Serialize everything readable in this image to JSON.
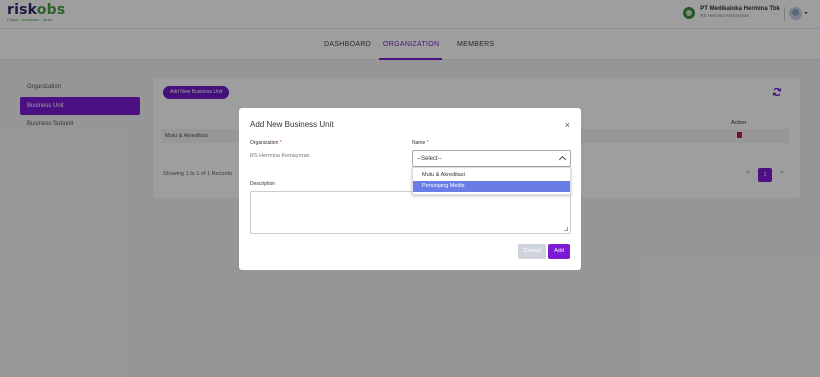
{
  "brand": {
    "name_main": "risk",
    "name_accent": "obs",
    "tagline": "Fokus - Komitmen - Mutu"
  },
  "company": {
    "name": "PT Medikaloka Hermina Tbk",
    "subtitle": "RS Hermina Kemayoran",
    "avatar_icon": "user-avatar-icon"
  },
  "nav": {
    "items": [
      "DASHBOARD",
      "ORGANIZATION",
      "MEMBERS"
    ],
    "active": "ORGANIZATION"
  },
  "sidebar": {
    "items": [
      "Organization",
      "Business Unit",
      "Business Subunit"
    ],
    "active": "Business Unit"
  },
  "main": {
    "add_button": "Add New Business Unit",
    "refresh_icon": "refresh-icon",
    "table": {
      "action_header": "Action",
      "rows": [
        {
          "name": "Mutu & Akreditasi",
          "action_icon": "trash-icon"
        }
      ]
    },
    "showing_text": "Showing 1 to 1 of 1 Records",
    "pagination": {
      "prev": "«",
      "current": "1",
      "next": "»"
    }
  },
  "modal": {
    "title": "Add New Business Unit",
    "close_icon": "×",
    "organization_label": "Organization",
    "organization_value": "RS Hermina Kemayoran",
    "name_label": "Name",
    "required_mark": "*",
    "name_select_value": "--Select--",
    "name_options": [
      "Mutu & Akreditasi",
      "Penunjang Medis"
    ],
    "highlighted_option": "Penunjang Medis",
    "description_label": "Description",
    "description_value": "",
    "cancel_label": "Cancel",
    "add_label": "Add"
  },
  "colors": {
    "accent": "#7d1ad4",
    "danger": "#c2185b",
    "option_highlight": "#6a7de6",
    "brand_green": "#43a047",
    "brand_navy": "#2e2a6e"
  }
}
